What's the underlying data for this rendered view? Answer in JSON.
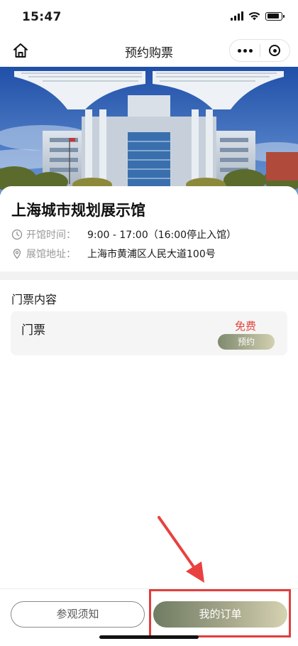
{
  "status_bar": {
    "time": "15:47"
  },
  "nav": {
    "title": "预约购票",
    "home_icon": "home-icon",
    "more_icon": "more-icon",
    "close_icon": "close-icon"
  },
  "venue": {
    "name": "上海城市规划展示馆",
    "hours_label": "开馆时间：",
    "hours_value": "9:00 - 17:00（16:00停止入馆）",
    "address_label": "展馆地址：",
    "address_value": "上海市黄浦区人民大道100号"
  },
  "tickets": {
    "section_title": "门票内容",
    "items": [
      {
        "name": "门票",
        "price": "免费",
        "action": "预约"
      }
    ]
  },
  "bottom": {
    "notice_label": "参观须知",
    "orders_label": "我的订单"
  },
  "colors": {
    "accent_gradient_start": "#6f7c62",
    "accent_gradient_end": "#d6d2b2",
    "price_red": "#e0463f",
    "annotation_red": "#e23d3d"
  }
}
